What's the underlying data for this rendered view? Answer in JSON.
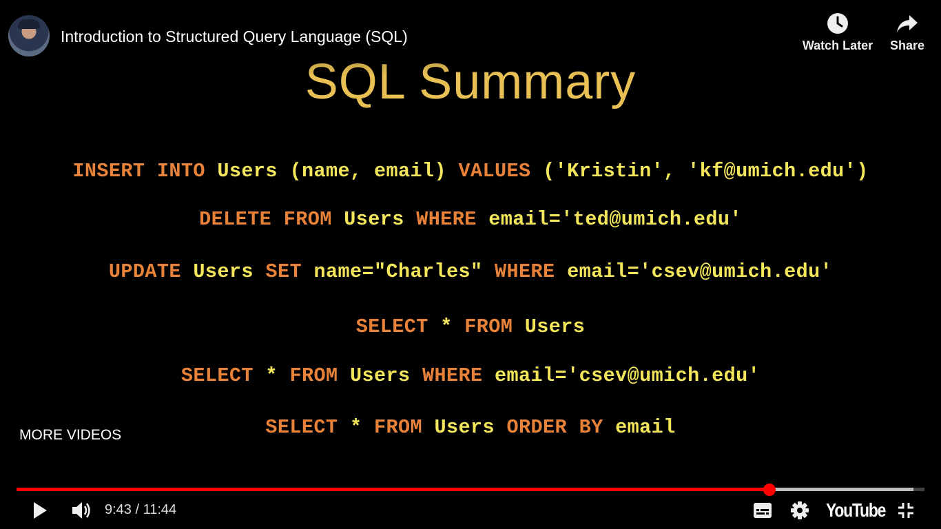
{
  "video": {
    "title": "Introduction to Structured Query Language (SQL)"
  },
  "top_actions": {
    "watch_later_label": "Watch Later",
    "share_label": "Share"
  },
  "slide": {
    "title": "SQL Summary",
    "lines": [
      [
        {
          "t": "INSERT",
          "k": "kw"
        },
        {
          "t": " "
        },
        {
          "t": "INTO",
          "k": "kw"
        },
        {
          "t": " "
        },
        {
          "t": "Users",
          "k": "id"
        },
        {
          "t": " "
        },
        {
          "t": "(name,",
          "k": "id"
        },
        {
          "t": " "
        },
        {
          "t": "email)",
          "k": "id"
        },
        {
          "t": " "
        },
        {
          "t": "VALUES",
          "k": "kw"
        },
        {
          "t": " "
        },
        {
          "t": "('Kristin',",
          "k": "id"
        },
        {
          "t": " "
        },
        {
          "t": "'kf@umich.edu')",
          "k": "id"
        }
      ],
      [
        {
          "t": "DELETE",
          "k": "kw"
        },
        {
          "t": " "
        },
        {
          "t": "FROM",
          "k": "kw"
        },
        {
          "t": " "
        },
        {
          "t": "Users",
          "k": "id"
        },
        {
          "t": " "
        },
        {
          "t": "WHERE",
          "k": "kw"
        },
        {
          "t": " "
        },
        {
          "t": "email='ted@umich.edu'",
          "k": "id"
        }
      ],
      [
        {
          "t": "UPDATE",
          "k": "kw"
        },
        {
          "t": " "
        },
        {
          "t": "Users",
          "k": "id"
        },
        {
          "t": " "
        },
        {
          "t": "SET",
          "k": "kw"
        },
        {
          "t": " "
        },
        {
          "t": "name=\"Charles\"",
          "k": "id"
        },
        {
          "t": " "
        },
        {
          "t": "WHERE",
          "k": "kw"
        },
        {
          "t": " "
        },
        {
          "t": "email='csev@umich.edu'",
          "k": "id"
        }
      ],
      [
        {
          "t": "SELECT",
          "k": "kw"
        },
        {
          "t": " "
        },
        {
          "t": "*",
          "k": "id"
        },
        {
          "t": " "
        },
        {
          "t": "FROM",
          "k": "kw"
        },
        {
          "t": " "
        },
        {
          "t": "Users",
          "k": "id"
        }
      ],
      [
        {
          "t": "SELECT",
          "k": "kw"
        },
        {
          "t": " "
        },
        {
          "t": "*",
          "k": "id"
        },
        {
          "t": " "
        },
        {
          "t": "FROM",
          "k": "kw"
        },
        {
          "t": " "
        },
        {
          "t": "Users",
          "k": "id"
        },
        {
          "t": " "
        },
        {
          "t": "WHERE",
          "k": "kw"
        },
        {
          "t": " "
        },
        {
          "t": "email='csev@umich.edu'",
          "k": "id"
        }
      ],
      [
        {
          "t": "SELECT",
          "k": "kw"
        },
        {
          "t": " "
        },
        {
          "t": "*",
          "k": "id"
        },
        {
          "t": " "
        },
        {
          "t": "FROM",
          "k": "kw"
        },
        {
          "t": " "
        },
        {
          "t": "Users",
          "k": "id"
        },
        {
          "t": " "
        },
        {
          "t": "ORDER",
          "k": "kw"
        },
        {
          "t": " "
        },
        {
          "t": "BY",
          "k": "kw"
        },
        {
          "t": " "
        },
        {
          "t": "email",
          "k": "id"
        }
      ]
    ]
  },
  "more_videos_label": "MORE VIDEOS",
  "player": {
    "current_time": "9:43",
    "duration": "11:44",
    "time_text": "9:43 / 11:44",
    "played_fraction": 0.829,
    "loaded_fraction": 0.988,
    "logo_text": "YouTube"
  },
  "icons": {
    "play": "play-icon",
    "volume": "volume-icon",
    "captions": "captions-icon",
    "settings": "gear-icon",
    "exit_fullscreen": "exit-fullscreen-icon",
    "watch_later": "clock-icon",
    "share": "share-arrow-icon"
  },
  "colors": {
    "keyword": "#e88238",
    "identifier": "#f3e65a",
    "title": "#e9c054",
    "progress_played": "#ff0000"
  }
}
